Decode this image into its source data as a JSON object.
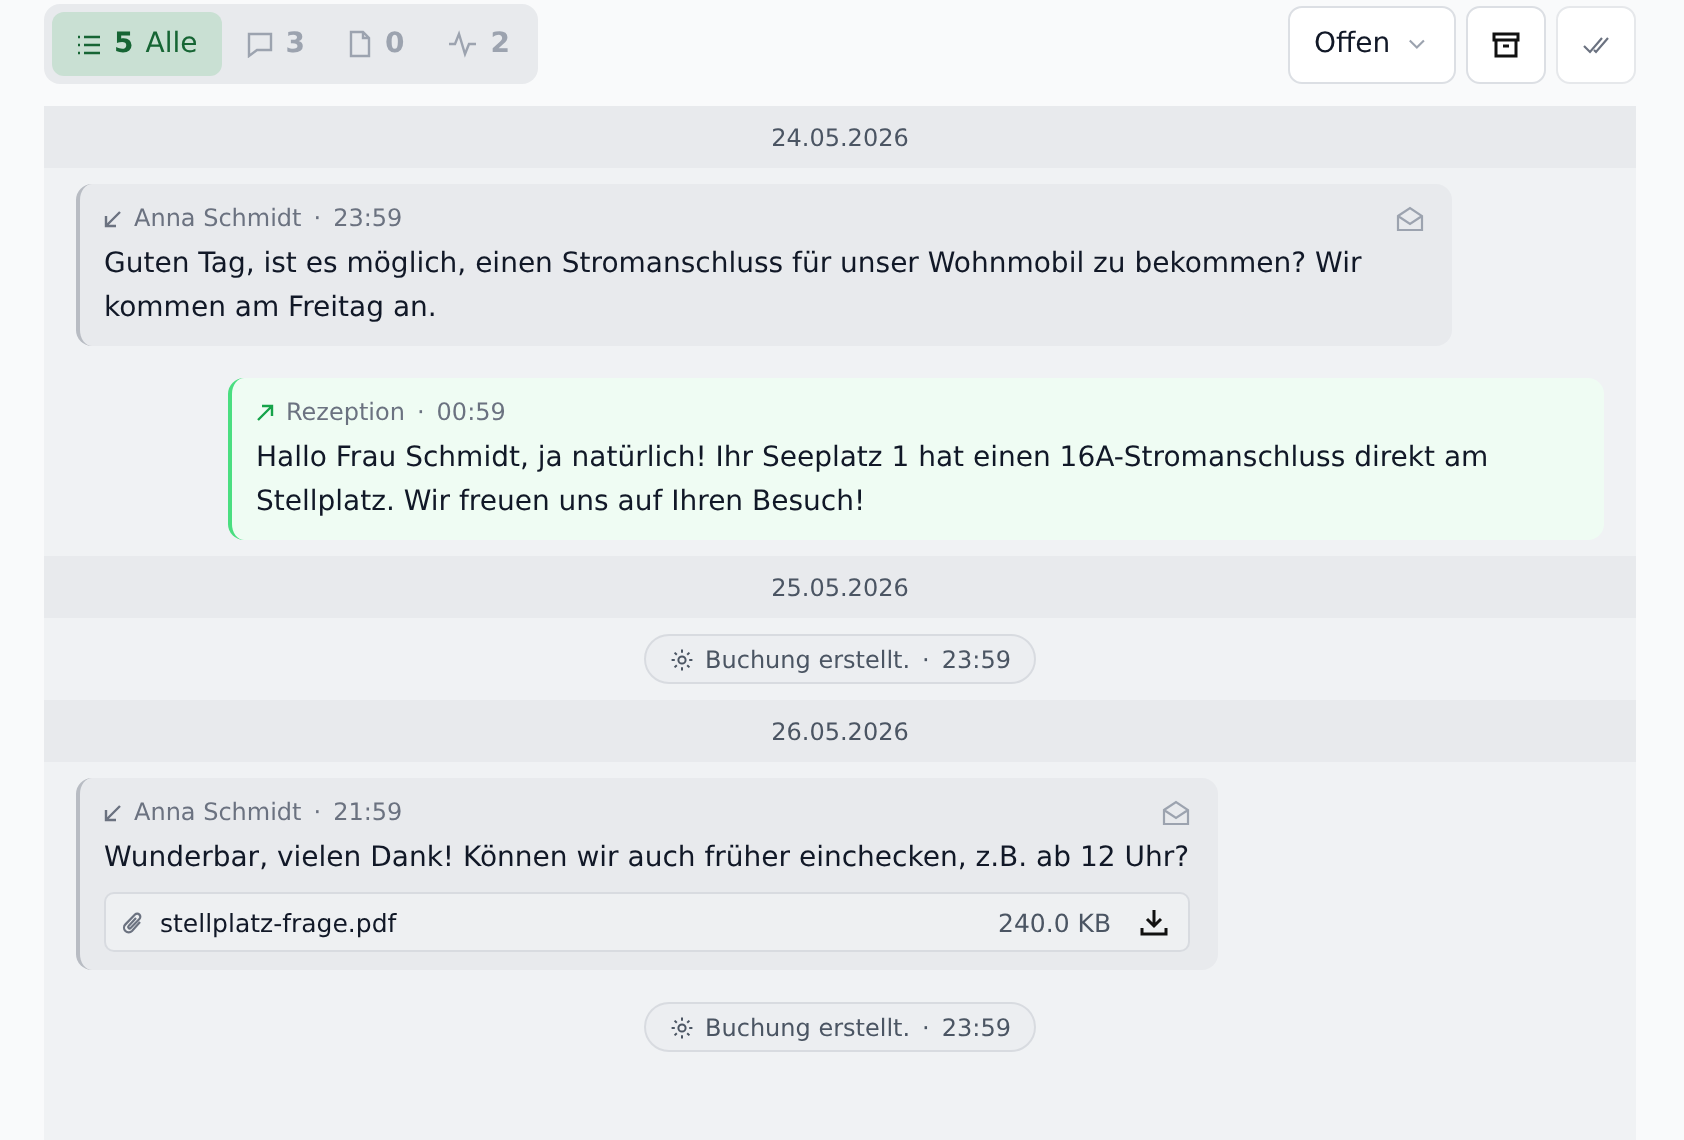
{
  "filters": [
    {
      "kind": "all",
      "count": "5",
      "label": "Alle",
      "selected": true
    },
    {
      "kind": "chat",
      "count": "3",
      "selected": false
    },
    {
      "kind": "doc",
      "count": "0",
      "selected": false
    },
    {
      "kind": "activity",
      "count": "2",
      "selected": false
    }
  ],
  "status_dropdown": {
    "value": "Offen"
  },
  "timeline": [
    {
      "kind": "date",
      "text": "24.05.2026"
    },
    {
      "kind": "incoming",
      "author": "Anna Schmidt",
      "separator": "·",
      "time": "23:59",
      "text": "Guten Tag, ist es möglich, einen Stromanschluss für unser Wohnmobil zu bekommen? Wir kommen am Freitag an."
    },
    {
      "kind": "outgoing",
      "author": "Rezeption",
      "separator": "·",
      "time": "00:59",
      "text": "Hallo Frau Schmidt, ja natürlich! Ihr Seeplatz 1 hat einen 16A-Stromanschluss direkt am Stellplatz. Wir freuen uns auf Ihren Besuch!"
    },
    {
      "kind": "date",
      "text": "25.05.2026"
    },
    {
      "kind": "event",
      "text": "Buchung erstellt.",
      "separator": "·",
      "time": "23:59"
    },
    {
      "kind": "date",
      "text": "26.05.2026"
    },
    {
      "kind": "incoming",
      "author": "Anna Schmidt",
      "separator": "·",
      "time": "21:59",
      "text": "Wunderbar, vielen Dank! Können wir auch früher einchecken, z.B. ab 12 Uhr?",
      "attachment": {
        "name": "stellplatz-frage.pdf",
        "size": "240.0 KB"
      }
    },
    {
      "kind": "event",
      "text": "Buchung erstellt.",
      "separator": "·",
      "time": "23:59"
    }
  ]
}
